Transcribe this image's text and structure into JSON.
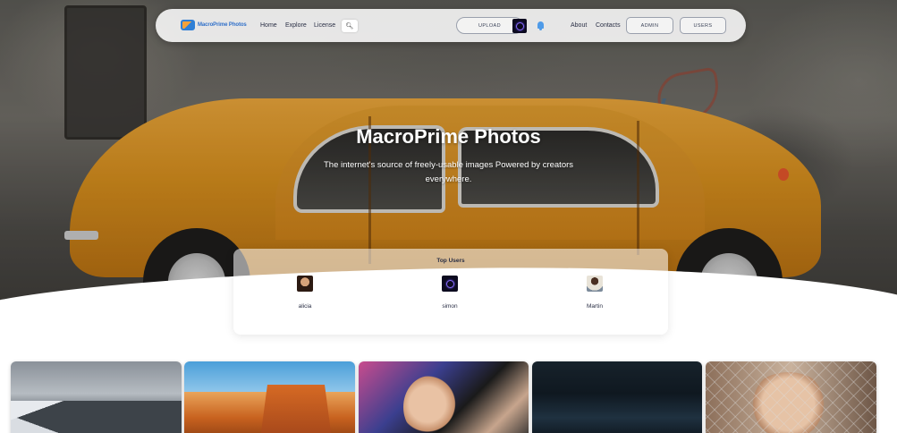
{
  "nav": {
    "logo_text": "MacroPrime Photos",
    "links": {
      "home": "Home",
      "explore": "Explore",
      "license": "License",
      "about": "About",
      "contacts": "Contacts"
    },
    "search_icon": "search-icon",
    "upload_label": "UPLOAD",
    "admin_label": "ADMIN",
    "users_label": "USERS"
  },
  "hero": {
    "title": "MacroPrime Photos",
    "subtitle": "The internet's source of freely-usable images Powered by creators everywhere."
  },
  "top_users": {
    "title": "Top Users",
    "users": [
      {
        "name": "alicia"
      },
      {
        "name": "simon"
      },
      {
        "name": "Martin"
      }
    ]
  },
  "colors": {
    "accent": "#2f7fd6",
    "text_dark": "#2a2f45",
    "car_orange": "#d28c1d"
  }
}
